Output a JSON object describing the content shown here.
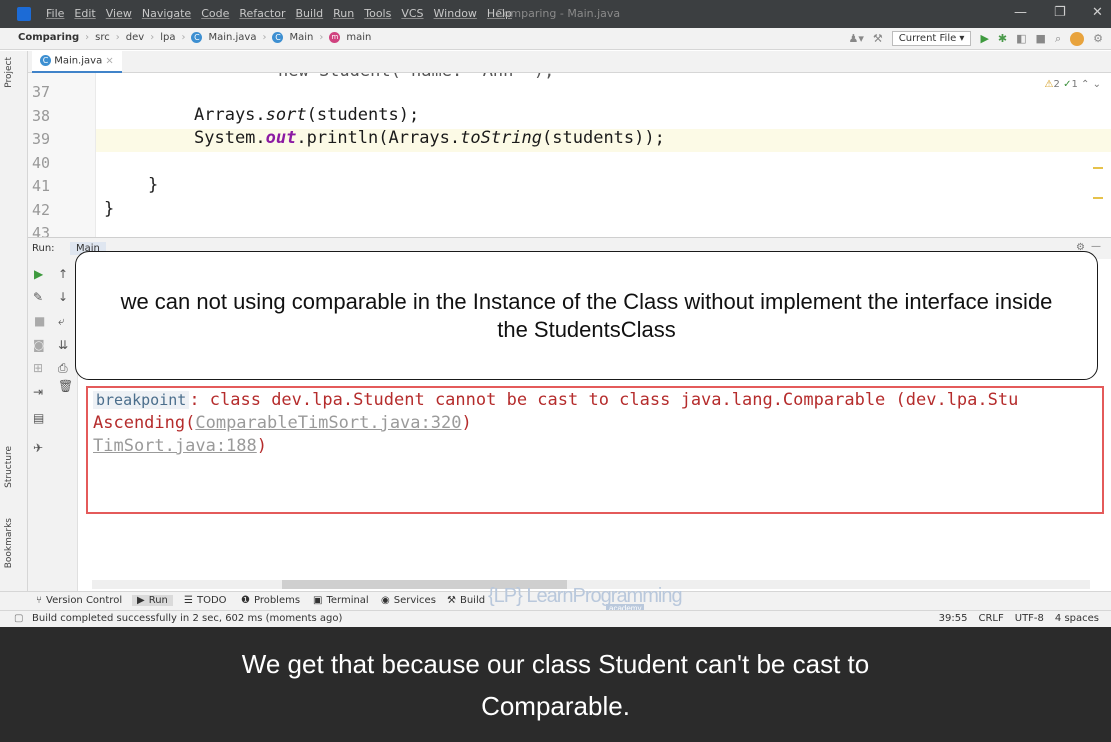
{
  "titlebar": {
    "menu": [
      "File",
      "Edit",
      "View",
      "Navigate",
      "Code",
      "Refactor",
      "Build",
      "Run",
      "Tools",
      "VCS",
      "Window",
      "Help"
    ],
    "window_title": "Comparing - Main.java",
    "controls": {
      "minimize": "—",
      "restore": "❐",
      "close": "✕"
    }
  },
  "navbar": {
    "project": "Comparing",
    "crumbs": [
      "src",
      "dev",
      "lpa",
      "Main.java",
      "Main",
      "main"
    ],
    "run_config": "Current File ▾"
  },
  "sidebar": {
    "project": "Project",
    "structure": "Structure",
    "bookmarks": "Bookmarks",
    "notifications": "Notifications"
  },
  "editor": {
    "tab": "Main.java",
    "line_numbers": [
      "37",
      "38",
      "39",
      "40",
      "41",
      "42",
      "43"
    ],
    "partial_top_line": "new Student( name: \"Ann\" ),",
    "lines": {
      "l38_prefix": "Arrays.",
      "l38_method": "sort",
      "l38_suffix": "(students);",
      "l39_a": "System.",
      "l39_out": "out",
      "l39_b": ".println(Arrays.",
      "l39_method": "toString",
      "l39_c": "(students));",
      "l41": "}",
      "l42": "}"
    },
    "inspections": {
      "warnings": "2",
      "ok": "1"
    }
  },
  "run_panel": {
    "label": "Run:",
    "tab": "Main"
  },
  "console": {
    "line1_badge": "breakpoint",
    "line1_text": ": class dev.lpa.Student cannot be cast to class java.lang.Comparable (dev.lpa.Stu",
    "line2_prefix": "Ascending(",
    "line2_link": "ComparableTimSort.java:320",
    "line2_suffix": ")",
    "line3_link": "TimSort.java:188",
    "line3_suffix": ")"
  },
  "callout": {
    "text": "we can not using comparable in the Instance of the Class without implement the interface inside the StudentsClass"
  },
  "tool_tabs": [
    {
      "icon": "version-control-icon",
      "glyph": "⑂",
      "label": "Version Control"
    },
    {
      "icon": "run-icon",
      "glyph": "▶",
      "label": "Run"
    },
    {
      "icon": "todo-icon",
      "glyph": "☰",
      "label": "TODO"
    },
    {
      "icon": "problems-icon",
      "glyph": "❶",
      "label": "Problems"
    },
    {
      "icon": "terminal-icon",
      "glyph": "▣",
      "label": "Terminal"
    },
    {
      "icon": "services-icon",
      "glyph": "◉",
      "label": "Services"
    },
    {
      "icon": "build-icon",
      "glyph": "⚒",
      "label": "Build"
    }
  ],
  "watermark": {
    "text": "{LP} LearnProgramming",
    "sub": "academy"
  },
  "statusbar": {
    "message": "Build completed successfully in 2 sec, 602 ms (moments ago)",
    "position": "39:55",
    "line_sep": "CRLF",
    "encoding": "UTF-8",
    "indent": "4 spaces"
  },
  "caption": {
    "text": "We get that because our class Student can't be cast to Comparable."
  },
  "colors": {
    "accent": "#4083c9",
    "error": "#b52c2c",
    "error_border": "#e45a5a",
    "caption_bg": "#2b2b2b"
  }
}
